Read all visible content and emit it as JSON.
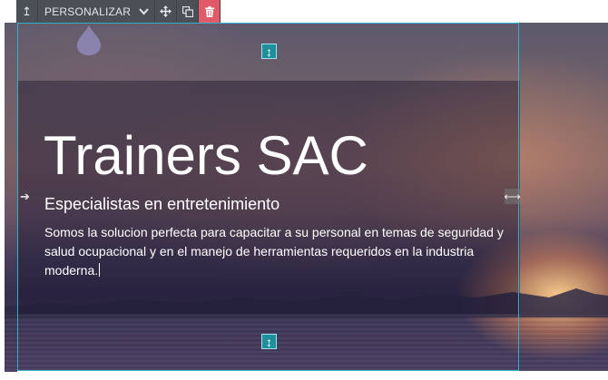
{
  "toolbar": {
    "parent_icon": "↥",
    "personalize_label": "PERSONALIZAR",
    "chevron_icon": "chevron-down-icon",
    "move_icon": "move-icon",
    "duplicate_icon": "duplicate-icon",
    "delete_icon": "trash-icon"
  },
  "colors": {
    "selection_border": "#31b0c9",
    "handle": "#1f8f9c",
    "delete": "#e05a6a",
    "toolbar_bg": "#4b4f56"
  },
  "hero": {
    "title": "Trainers SAC",
    "subtitle": "Especialistas en entretenimiento",
    "lead": "Somos la solucion perfecta para capacitar a su personal en temas de seguridad y salud ocupacional y en el manejo de herramientas requeridos en la industria moderna."
  },
  "handles": {
    "top_icon": "↕",
    "bottom_icon": "↕",
    "left_icon": "➔",
    "right_icon": "⟷"
  }
}
